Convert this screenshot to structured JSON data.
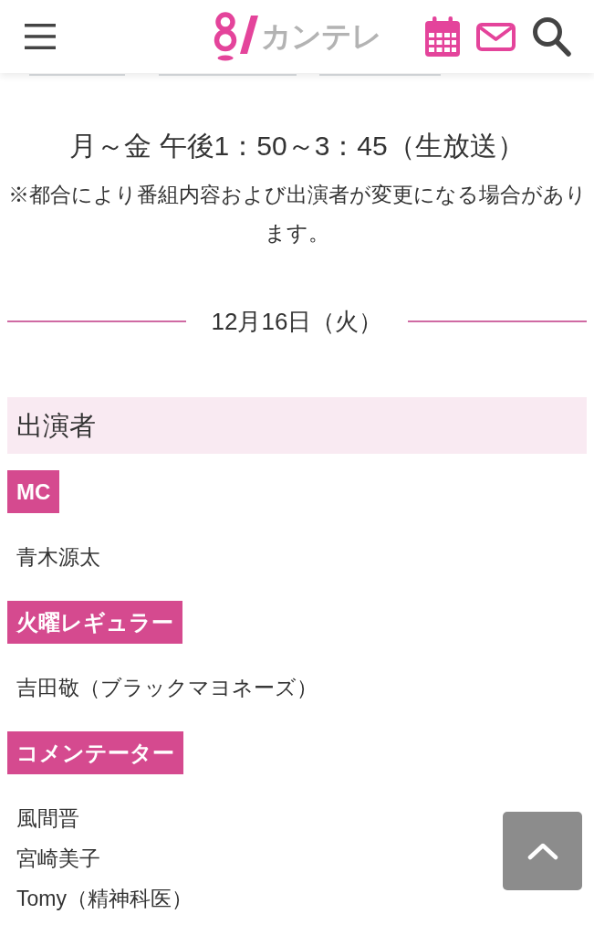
{
  "header": {
    "logo_text": "カンテレ"
  },
  "schedule": {
    "airtime": "月～金 午後1：50～3：45（生放送）",
    "notice": "※都合により番組内容および出演者が変更になる場合があります。"
  },
  "date": "12月16日（火）",
  "cast": {
    "title": "出演者",
    "groups": [
      {
        "role": "MC",
        "members": [
          "青木源太"
        ]
      },
      {
        "role": "火曜レギュラー",
        "members": [
          "吉田敬（ブラックマヨネーズ）"
        ]
      },
      {
        "role": "コメンテーター",
        "members": [
          "風間晋",
          "宮崎美子",
          "Tomy（精神科医）"
        ]
      }
    ]
  }
}
